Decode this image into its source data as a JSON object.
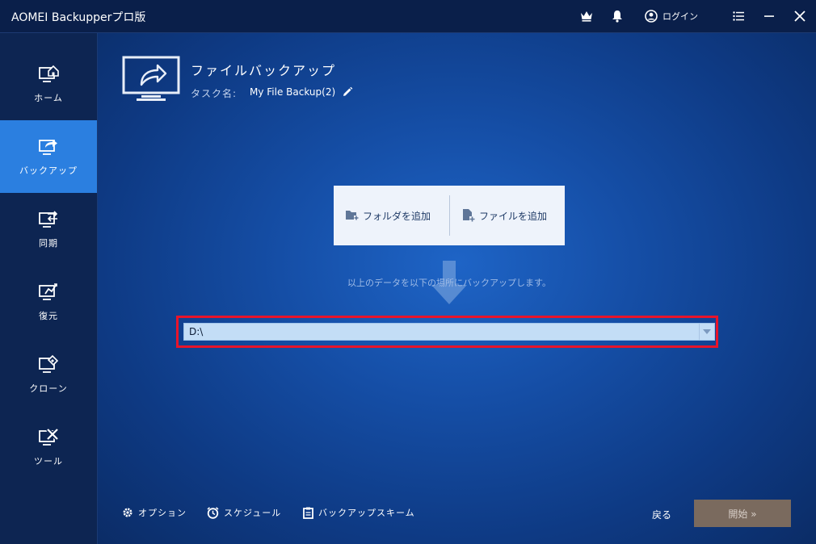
{
  "app": {
    "title": "AOMEI Backupperプロ版",
    "login_label": "ログイン"
  },
  "sidebar": {
    "items": [
      {
        "label": "ホーム",
        "icon": "home-icon"
      },
      {
        "label": "バックアップ",
        "icon": "backup-icon"
      },
      {
        "label": "同期",
        "icon": "sync-icon"
      },
      {
        "label": "復元",
        "icon": "restore-icon"
      },
      {
        "label": "クローン",
        "icon": "clone-icon"
      },
      {
        "label": "ツール",
        "icon": "tools-icon"
      }
    ],
    "active_index": 1
  },
  "header": {
    "title": "ファイルバックアップ",
    "task_label": "タスク名:",
    "task_name": "My File Backup(2)"
  },
  "source": {
    "add_folder": "フォルダを追加",
    "add_file": "ファイルを追加"
  },
  "hint": "以上のデータを以下の場所にバックアップします。",
  "destination": {
    "value": "D:\\"
  },
  "footer": {
    "options": "オプション",
    "schedule": "スケジュール",
    "scheme": "バックアップスキーム",
    "back": "戻る",
    "start": "開始 »"
  },
  "colors": {
    "accent": "#2b7fe0",
    "highlight": "#e8142a",
    "start_button": "#7a6a5e"
  }
}
